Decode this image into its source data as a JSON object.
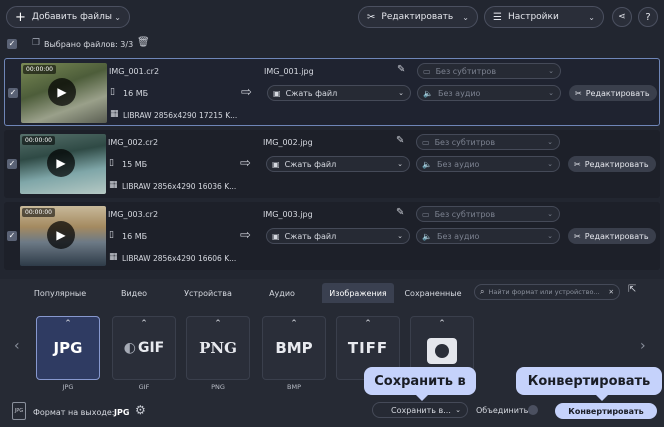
{
  "toolbar": {
    "add_files": "Добавить файлы",
    "edit": "Редактировать",
    "settings": "Настройки"
  },
  "selection": {
    "label": "Выбрано файлов: 3/3"
  },
  "files": [
    {
      "duration": "00:00:00",
      "source_name": "IMG_001.cr2",
      "size": "16 МБ",
      "meta": "LIBRAW 2856x4290 17215 K...",
      "output_name": "IMG_001.jpg",
      "compress": "Сжать файл",
      "subtitles": "Без субтитров",
      "audio": "Без аудио",
      "edit": "Редактировать"
    },
    {
      "duration": "00:00:00",
      "source_name": "IMG_002.cr2",
      "size": "15 МБ",
      "meta": "LIBRAW 2856x4290 16036 K...",
      "output_name": "IMG_002.jpg",
      "compress": "Сжать файл",
      "subtitles": "Без субтитров",
      "audio": "Без аудио",
      "edit": "Редактировать"
    },
    {
      "duration": "00:00:00",
      "source_name": "IMG_003.cr2",
      "size": "16 МБ",
      "meta": "LIBRAW 2856x4290 16606 K...",
      "output_name": "IMG_003.jpg",
      "compress": "Сжать файл",
      "subtitles": "Без субтитров",
      "audio": "Без аудио",
      "edit": "Редактировать"
    }
  ],
  "tabs": [
    "Популярные",
    "Видео",
    "Устройства",
    "Аудио",
    "Изображения",
    "Сохраненные"
  ],
  "active_tab": "Изображения",
  "search": {
    "placeholder": "Найти формат или устройство..."
  },
  "formats": [
    {
      "display": "JPG",
      "label": "JPG"
    },
    {
      "display": "GIF",
      "label": "GIF"
    },
    {
      "display": "PNG",
      "label": "PNG"
    },
    {
      "display": "BMP",
      "label": "BMP"
    },
    {
      "display": "TIFF",
      "label": ""
    },
    {
      "display": "",
      "label": ""
    }
  ],
  "output": {
    "label": "Формат на выходе:",
    "format": "JPG",
    "save_to": "Сохранить в...",
    "merge": "Объединить:",
    "convert": "Конвертировать"
  },
  "callouts": {
    "save": "Сохранить в",
    "convert": "Конвертировать"
  },
  "colors": {
    "accent": "#c5d2fb",
    "active_format": "#2f3b62",
    "background": "#222630"
  }
}
